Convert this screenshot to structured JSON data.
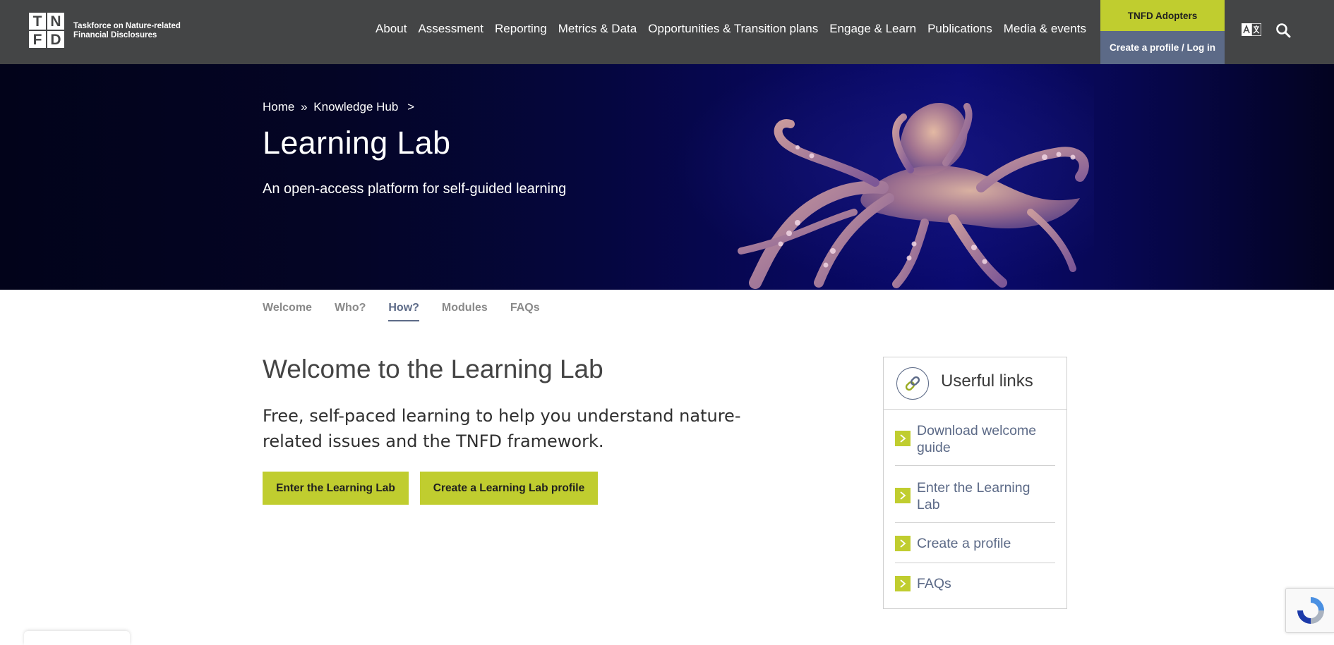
{
  "header": {
    "logo_letters": [
      "T",
      "N",
      "F",
      "D"
    ],
    "logo_text_line1": "Taskforce on Nature-related",
    "logo_text_line2": "Financial Disclosures",
    "nav": [
      {
        "label": "About"
      },
      {
        "label": "Assessment"
      },
      {
        "label": "Reporting"
      },
      {
        "label": "Metrics & Data"
      },
      {
        "label": "Opportunities & Transition plans"
      },
      {
        "label": "Engage & Learn"
      },
      {
        "label": "Publications"
      },
      {
        "label": "Media & events"
      }
    ],
    "adopters_label": "TNFD Adopters",
    "login_label": "Create a profile / Log in",
    "icons": [
      "translate-icon",
      "search-icon"
    ]
  },
  "hero": {
    "breadcrumb_home": "Home",
    "breadcrumb_sep": "»",
    "breadcrumb_hub": "Knowledge Hub",
    "breadcrumb_arrow": ">",
    "title": "Learning Lab",
    "subtitle": "An open-access platform for self-guided learning"
  },
  "tabs": [
    {
      "label": "Welcome",
      "active": false
    },
    {
      "label": "Who?",
      "active": false
    },
    {
      "label": "How?",
      "active": true
    },
    {
      "label": "Modules",
      "active": false
    },
    {
      "label": "FAQs",
      "active": false
    }
  ],
  "main": {
    "title": "Welcome to the Learning Lab",
    "description": "Free, self-paced learning to help you understand nature-related issues and the TNFD framework.",
    "enter_button": "Enter the Learning Lab",
    "profile_button": "Create a Learning Lab profile"
  },
  "useful_links": {
    "title": "Userful links",
    "items": [
      {
        "label": "Download welcome guide"
      },
      {
        "label": "Enter the Learning Lab"
      },
      {
        "label": "Create a profile"
      },
      {
        "label": "FAQs"
      }
    ]
  },
  "colors": {
    "header_bg": "#444546",
    "accent_green": "#c0cd2f",
    "accent_slate": "#5c6a87",
    "hero_dark": "#02031a"
  }
}
